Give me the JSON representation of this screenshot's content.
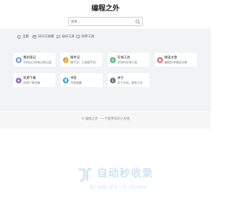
{
  "header": {
    "site_title": "编程之外",
    "search_placeholder": "搜索...",
    "search_icon": "search-icon"
  },
  "tabs": [
    {
      "label": "全部",
      "icon": "home-icon"
    },
    {
      "label": "SEO工具箱",
      "icon": "box-icon"
    },
    {
      "label": "站长工具",
      "icon": "chat-icon"
    },
    {
      "label": "效率工具",
      "icon": "monitor-icon"
    }
  ],
  "cards": [
    {
      "title": "我的笔记",
      "desc": "写给自己的笔记和记录",
      "icon": "notebook-icon",
      "color": "#5b8fd0"
    },
    {
      "title": "随手记",
      "desc": "随手记，工具随手用",
      "icon": "pen-icon",
      "color": "#e5a23a"
    },
    {
      "title": "在线工具",
      "desc": "实用的在线工具",
      "icon": "tools-icon",
      "color": "#3fae6a"
    },
    {
      "title": "精选文章",
      "desc": "编程技术精选文章",
      "icon": "book-icon",
      "color": "#d9534f"
    },
    {
      "title": "资源下载",
      "desc": "资源下载合集",
      "icon": "download-icon",
      "color": "#8a6bd1"
    },
    {
      "title": "书签",
      "desc": "书签收藏",
      "icon": "bookmark-icon",
      "color": "#2fa3c9"
    },
    {
      "title": "关于",
      "desc": "关于本站，联系方式",
      "icon": "info-icon",
      "color": "#6c757d"
    }
  ],
  "footer": {
    "text": "© 编程之外 · 一个程序员的小天地"
  },
  "watermark": {
    "title": "自动秒收录",
    "subtitle": "做上链接→来访一次→自动收录"
  }
}
